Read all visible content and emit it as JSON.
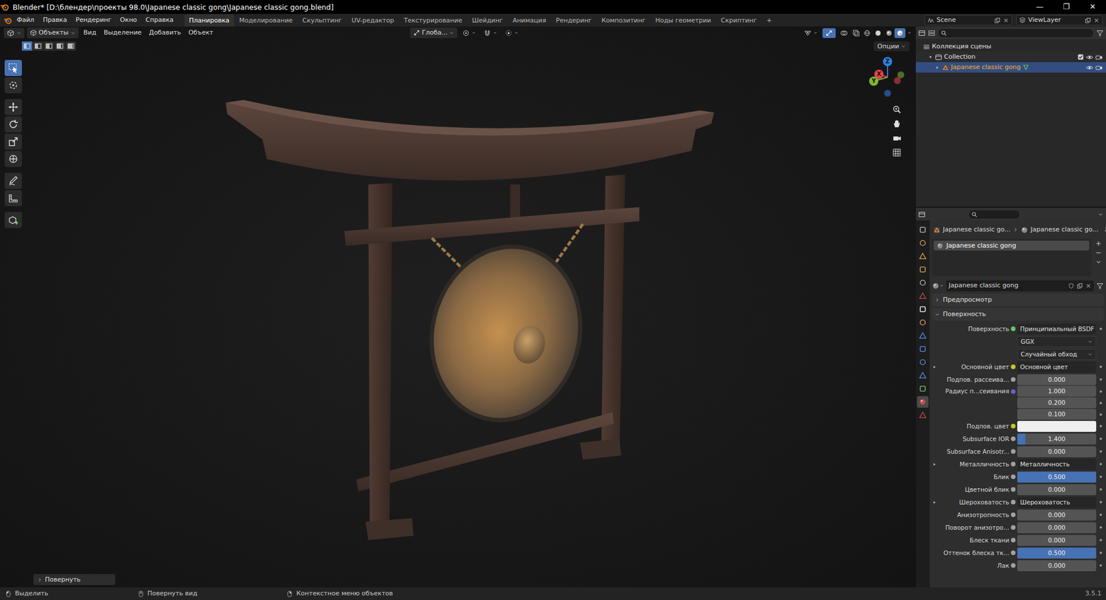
{
  "window": {
    "title": "Blender* [D:\\блендер\\проекты 98.0\\Japanese classic gong\\Japanese classic gong.blend]",
    "controls": [
      "—",
      "❐",
      "✕"
    ]
  },
  "menus": [
    "Файл",
    "Правка",
    "Рендеринг",
    "Окно",
    "Справка"
  ],
  "workspaces": [
    {
      "label": "Планировка",
      "selected": true
    },
    {
      "label": "Моделирование",
      "selected": false
    },
    {
      "label": "Скульптинг",
      "selected": false
    },
    {
      "label": "UV-редактор",
      "selected": false
    },
    {
      "label": "Текстурирование",
      "selected": false
    },
    {
      "label": "Шейдинг",
      "selected": false
    },
    {
      "label": "Анимация",
      "selected": false
    },
    {
      "label": "Рендеринг",
      "selected": false
    },
    {
      "label": "Композитинг",
      "selected": false
    },
    {
      "label": "Ноды геометрии",
      "selected": false
    },
    {
      "label": "Скриптинг",
      "selected": false
    }
  ],
  "add_workspace": "+",
  "scene": "Scene",
  "view_layer": "ViewLayer",
  "viewport": {
    "mode": "Объекты",
    "menus": [
      "Вид",
      "Выделение",
      "Добавить",
      "Объект"
    ],
    "orientation": "Глоба...",
    "options": "Опции",
    "last_operator": "Повернуть",
    "show_gizmo": true,
    "show_overlays": false,
    "select_modes": [
      {
        "selected": true
      },
      {
        "selected": false
      },
      {
        "selected": false
      },
      {
        "selected": false
      },
      {
        "selected": false
      }
    ],
    "tools": [
      {
        "selected": true
      },
      {
        "selected": false
      },
      {
        "selected": false
      },
      {
        "selected": false
      },
      {
        "selected": false
      },
      {
        "selected": false
      },
      {
        "selected": false
      },
      {
        "selected": false
      },
      {
        "selected": false
      }
    ],
    "shading": [
      {
        "selected": false
      },
      {
        "selected": false
      },
      {
        "selected": false
      },
      {
        "selected": true
      }
    ],
    "gizmo": [
      {
        "label": "Z",
        "color": "#2f7fe6"
      },
      {
        "label": "X",
        "color": "#e8424e"
      },
      {
        "label": "Y",
        "color": "#7cb833"
      }
    ]
  },
  "outliner": {
    "rows": [
      {
        "label": "Коллекция сцены",
        "kind": "scene",
        "depth": 0,
        "expanded": true,
        "selected": false,
        "checked": false
      },
      {
        "label": "Collection",
        "kind": "collection",
        "depth": 1,
        "expanded": true,
        "selected": false,
        "checked": true
      },
      {
        "label": "Japanese classic gong",
        "kind": "object",
        "depth": 2,
        "expanded": false,
        "selected": true,
        "checked": false
      }
    ]
  },
  "properties": {
    "tabs": [
      {
        "selected": false
      },
      {
        "selected": false
      },
      {
        "selected": false
      },
      {
        "selected": false
      },
      {
        "selected": false
      },
      {
        "selected": false
      },
      {
        "selected": false
      },
      {
        "selected": false
      },
      {
        "selected": false
      },
      {
        "selected": false
      },
      {
        "selected": false
      },
      {
        "selected": false
      },
      {
        "selected": false
      },
      {
        "selected": true
      },
      {
        "selected": false
      }
    ],
    "breadcrumb": [
      "Japanese classic go...",
      "Japanese classic go..."
    ],
    "slots": [
      {
        "label": "Japanese classic gong",
        "selected": true
      }
    ],
    "material": "Japanese classic gong",
    "sections": [
      {
        "label": "Предпросмотр",
        "expanded": false
      },
      {
        "label": "Поверхность",
        "expanded": true
      }
    ],
    "rows": [
      {
        "kind": "socket",
        "label": "Поверхность",
        "value": "Принципиальный BSDF",
        "color": "#63c763"
      },
      {
        "kind": "menu",
        "value": "GGX"
      },
      {
        "kind": "menu",
        "value": "Случайный обход"
      },
      {
        "kind": "link",
        "label": "Основной цвет",
        "value": "Основной цвет",
        "color": "#c7c729",
        "expanded": false
      },
      {
        "kind": "number",
        "label": "Подпов. рассеива...",
        "value": "0.000",
        "level": 0,
        "color": "#a1a1a1"
      },
      {
        "kind": "vector",
        "label": "Радиус п...сеивания",
        "values": [
          "1.000",
          "0.200",
          "0.100"
        ],
        "color": "#6363c7"
      },
      {
        "kind": "swatch",
        "label": "Подпов. цвет",
        "swatch": "#f0f0f0",
        "color": "#c7c729"
      },
      {
        "kind": "number",
        "label": "Subsurface IOR",
        "value": "1.400",
        "level": 0.1,
        "color": "#a1a1a1"
      },
      {
        "kind": "number",
        "label": "Subsurface Anisotr...",
        "value": "0.000",
        "level": 0,
        "color": "#a1a1a1"
      },
      {
        "kind": "link",
        "label": "Металличность",
        "value": "Металличность",
        "color": "#a1a1a1",
        "expanded": false
      },
      {
        "kind": "number",
        "label": "Блик",
        "value": "0.500",
        "level": 1,
        "color": "#a1a1a1"
      },
      {
        "kind": "number",
        "label": "Цветной блик",
        "value": "0.000",
        "level": 0,
        "color": "#a1a1a1"
      },
      {
        "kind": "link",
        "label": "Шероховатость",
        "value": "Шероховатость",
        "color": "#a1a1a1",
        "expanded": false
      },
      {
        "kind": "number",
        "label": "Анизотропность",
        "value": "0.000",
        "level": 0,
        "color": "#a1a1a1"
      },
      {
        "kind": "number",
        "label": "Поворот анизотро...",
        "value": "0.000",
        "level": 0,
        "color": "#a1a1a1"
      },
      {
        "kind": "number",
        "label": "Блеск ткани",
        "value": "0.000",
        "level": 0,
        "color": "#a1a1a1"
      },
      {
        "kind": "number",
        "label": "Оттенок блеска тк...",
        "value": "0.500",
        "level": 1,
        "color": "#a1a1a1"
      },
      {
        "kind": "number",
        "label": "Лак",
        "value": "0.000",
        "level": 0,
        "color": "#a1a1a1"
      }
    ]
  },
  "status_bar": {
    "items": [
      "Выделить",
      "Повернуть вид",
      "Контекстное меню объектов"
    ],
    "version": "3.5.1"
  }
}
